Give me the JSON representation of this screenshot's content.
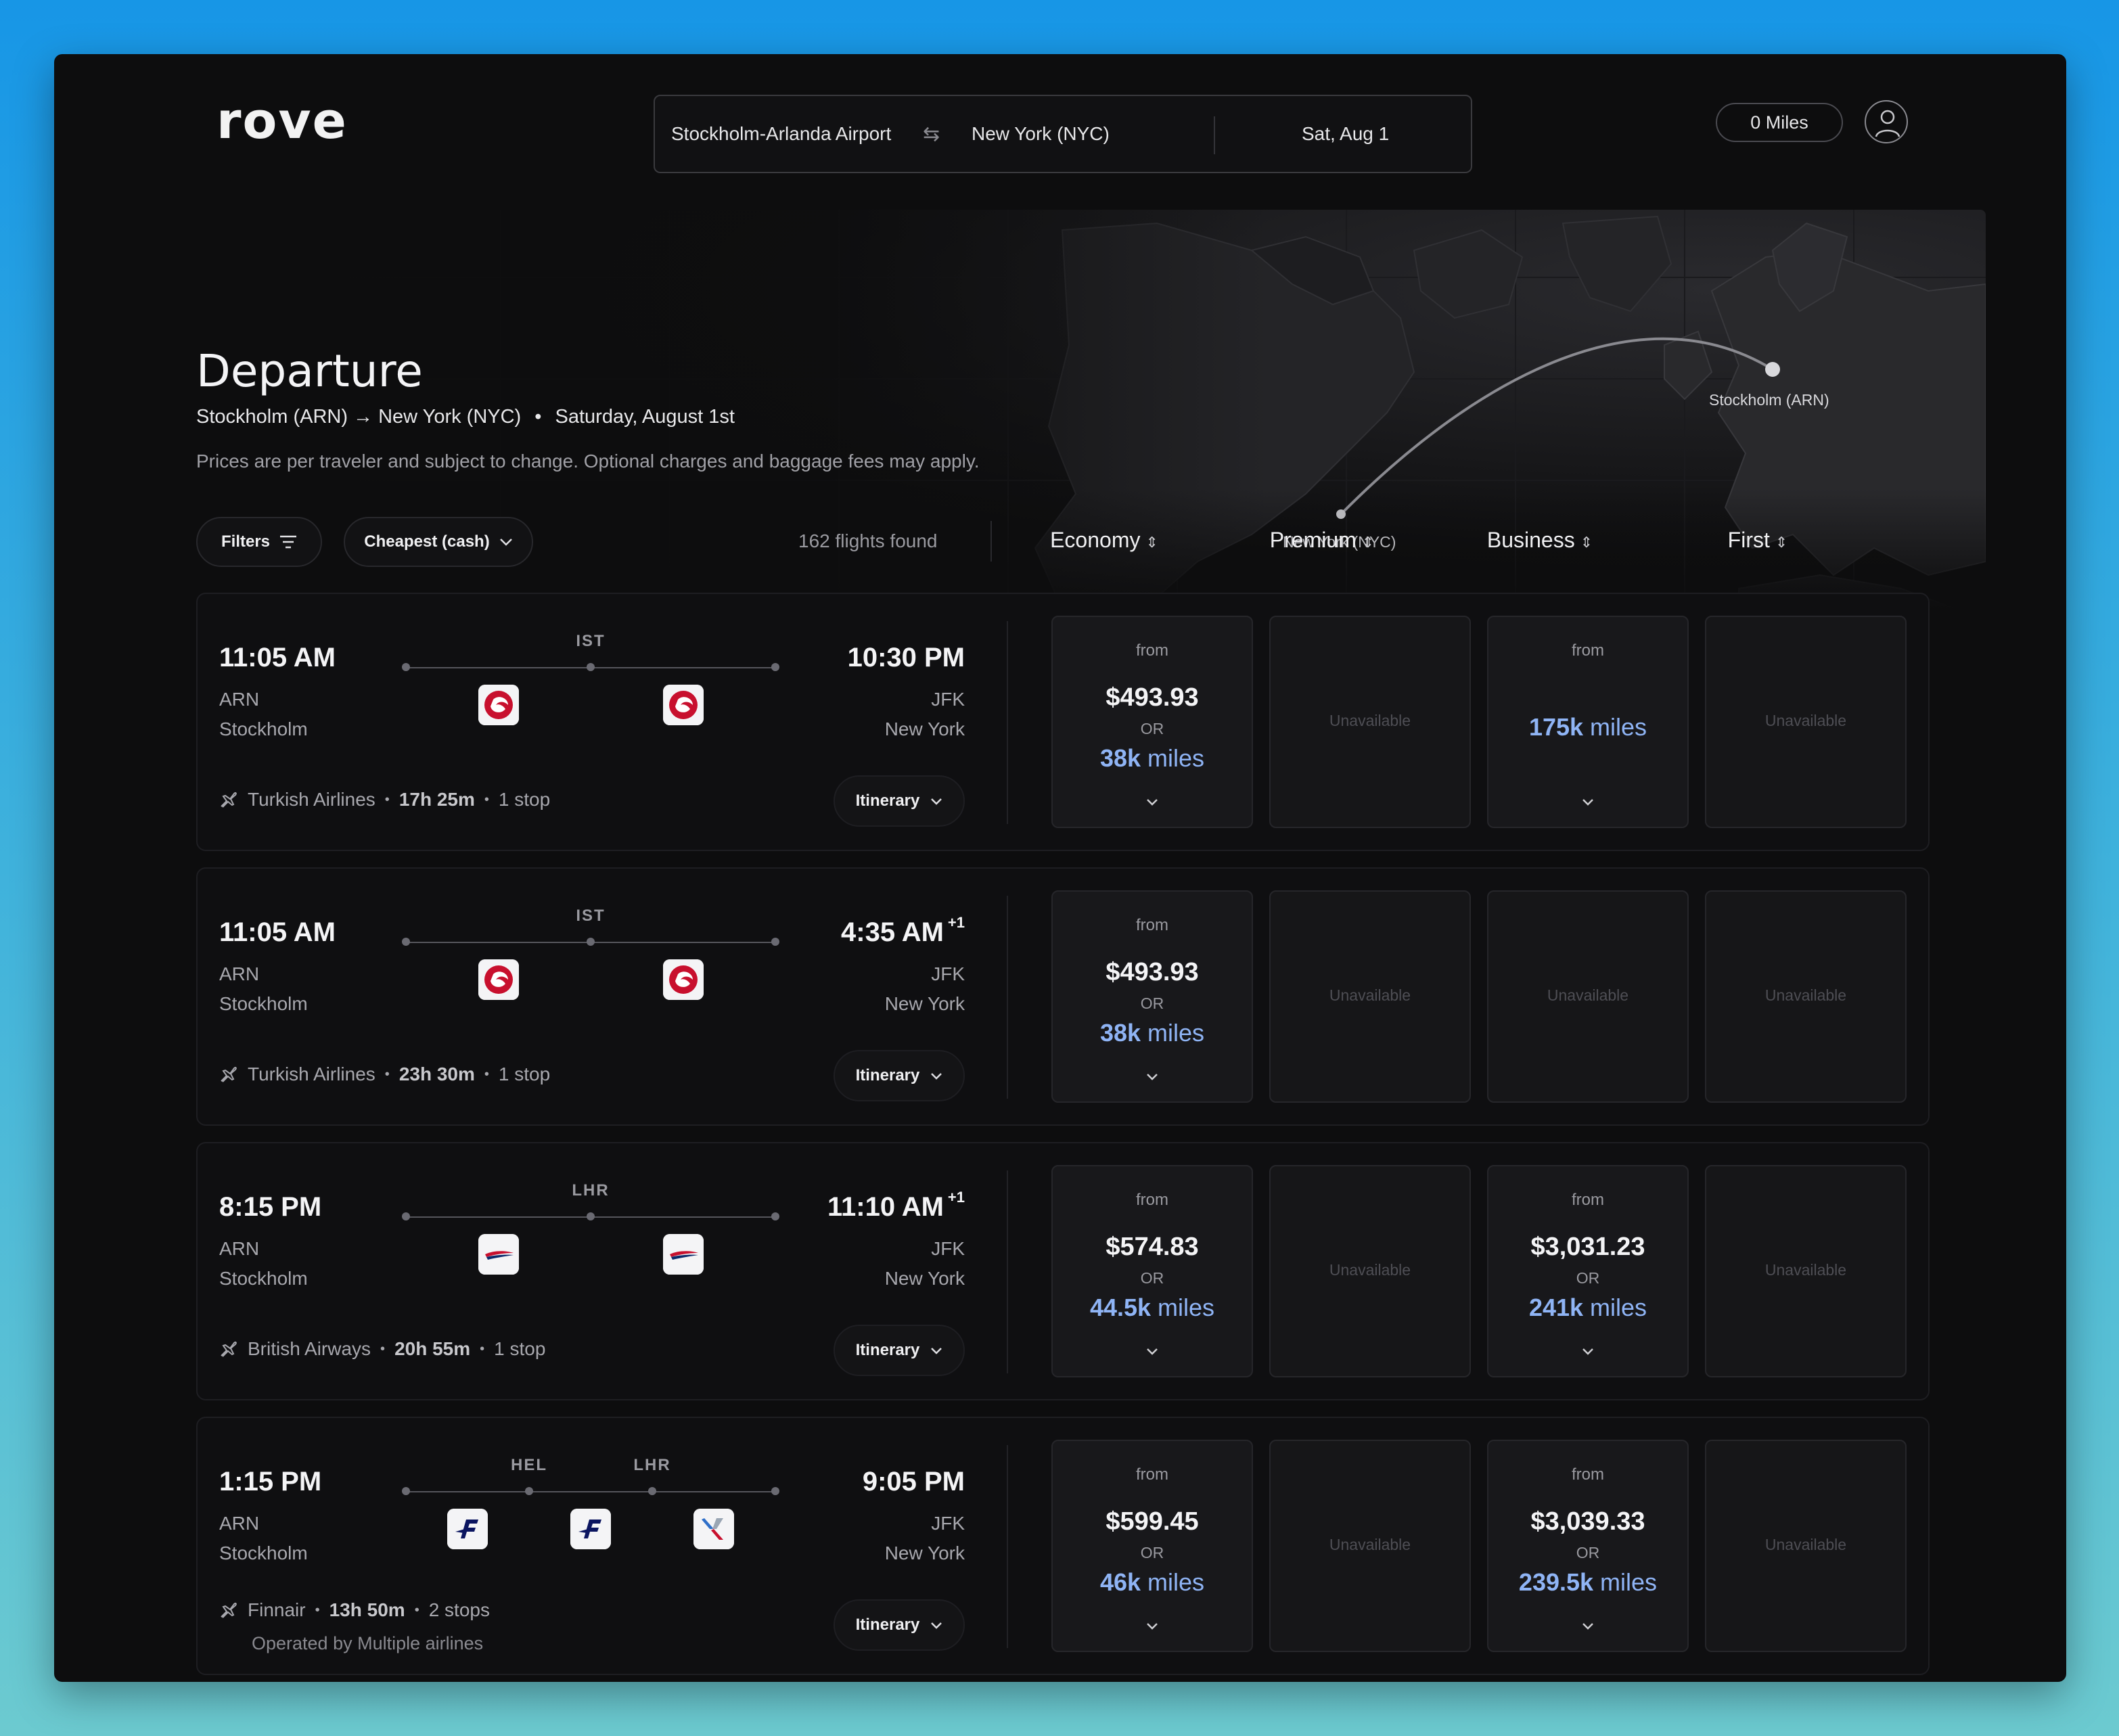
{
  "app": {
    "logo": "rove"
  },
  "search": {
    "origin": "Stockholm-Arlanda Airport",
    "destination": "New York (NYC)",
    "date": "Sat, Aug 1"
  },
  "header": {
    "miles": "0 Miles"
  },
  "map": {
    "origin_label": "Stockholm (ARN)",
    "dest_label": "New York (NYC)"
  },
  "page": {
    "title": "Departure",
    "route": "Stockholm (ARN) → New York (NYC)",
    "bullet": "•",
    "date": "Saturday, August 1st",
    "disclaimer": "Prices are per traveler and subject to change. Optional charges and baggage fees may apply."
  },
  "toolbar": {
    "filters_label": "Filters",
    "sort_label": "Cheapest (cash)",
    "flights_found": "162 flights found",
    "cabins": [
      "Economy",
      "Premium",
      "Business",
      "First"
    ]
  },
  "labels": {
    "from": "from",
    "or": "OR",
    "unavailable": "Unavailable",
    "itinerary": "Itinerary",
    "miles_suffix": "miles"
  },
  "flights": [
    {
      "dep_time": "11:05 AM",
      "dep_code": "ARN",
      "dep_city": "Stockholm",
      "arr_time": "10:30 PM",
      "arr_plus": "",
      "arr_code": "JFK",
      "arr_city": "New York",
      "stops_codes": [
        "IST"
      ],
      "logos": [
        "turkish",
        "turkish"
      ],
      "airline": "Turkish Airlines",
      "duration": "17h 25m",
      "stops": "1 stop",
      "operated": "",
      "prices": [
        {
          "cash": "$493.93",
          "miles": "38k"
        },
        null,
        {
          "cash": "",
          "miles": "175k"
        },
        null
      ]
    },
    {
      "dep_time": "11:05 AM",
      "dep_code": "ARN",
      "dep_city": "Stockholm",
      "arr_time": "4:35 AM",
      "arr_plus": "+1",
      "arr_code": "JFK",
      "arr_city": "New York",
      "stops_codes": [
        "IST"
      ],
      "logos": [
        "turkish",
        "turkish"
      ],
      "airline": "Turkish Airlines",
      "duration": "23h 30m",
      "stops": "1 stop",
      "operated": "",
      "prices": [
        {
          "cash": "$493.93",
          "miles": "38k"
        },
        null,
        null,
        null
      ]
    },
    {
      "dep_time": "8:15 PM",
      "dep_code": "ARN",
      "dep_city": "Stockholm",
      "arr_time": "11:10 AM",
      "arr_plus": "+1",
      "arr_code": "JFK",
      "arr_city": "New York",
      "stops_codes": [
        "LHR"
      ],
      "logos": [
        "british",
        "british"
      ],
      "airline": "British Airways",
      "duration": "20h 55m",
      "stops": "1 stop",
      "operated": "",
      "prices": [
        {
          "cash": "$574.83",
          "miles": "44.5k"
        },
        null,
        {
          "cash": "$3,031.23",
          "miles": "241k"
        },
        null
      ]
    },
    {
      "dep_time": "1:15 PM",
      "dep_code": "ARN",
      "dep_city": "Stockholm",
      "arr_time": "9:05 PM",
      "arr_plus": "",
      "arr_code": "JFK",
      "arr_city": "New York",
      "stops_codes": [
        "HEL",
        "LHR"
      ],
      "logos": [
        "finnair",
        "finnair",
        "american"
      ],
      "airline": "Finnair",
      "duration": "13h 50m",
      "stops": "2 stops",
      "operated": "Operated by Multiple airlines",
      "prices": [
        {
          "cash": "$599.45",
          "miles": "46k"
        },
        null,
        {
          "cash": "$3,039.33",
          "miles": "239.5k"
        },
        null
      ]
    }
  ],
  "colors": {
    "miles_accent": "#8fb4f5",
    "turkish_red": "#c8102e",
    "finnair_blue": "#0b1560"
  }
}
